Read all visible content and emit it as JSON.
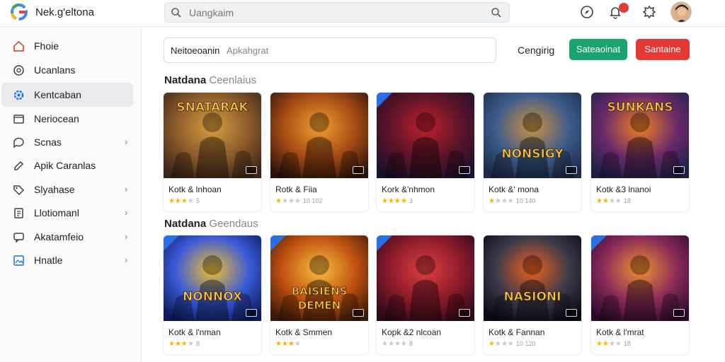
{
  "app": {
    "title": "Nek.g'eltona"
  },
  "search": {
    "placeholder": "Uangkaim"
  },
  "colors": {
    "accent_green": "#1aa36f",
    "accent_red": "#e53935",
    "ribbon_blue": "#2a6ee8",
    "star": "#f4b400"
  },
  "topbar": {
    "icons": [
      "compass-icon",
      "bell-icon",
      "settings-icon"
    ],
    "avatar": "user-avatar"
  },
  "sidebar": {
    "items": [
      {
        "label": "Fhoie",
        "icon": "home-icon",
        "chevron": false,
        "active": false
      },
      {
        "label": "Ucanlans",
        "icon": "circle-icon",
        "chevron": false,
        "active": false
      },
      {
        "label": "Kentcaban",
        "icon": "gear-icon",
        "chevron": false,
        "active": true
      },
      {
        "label": "Neriocean",
        "icon": "window-icon",
        "chevron": false,
        "active": false
      },
      {
        "label": "Scnas",
        "icon": "chat-icon",
        "chevron": true,
        "active": false
      },
      {
        "label": "Apik Caranlas",
        "icon": "pen-icon",
        "chevron": false,
        "active": false
      },
      {
        "label": "Slyahase",
        "icon": "tag-icon",
        "chevron": true,
        "active": false
      },
      {
        "label": "Llotiomanl",
        "icon": "document-icon",
        "chevron": true,
        "active": false
      },
      {
        "label": "Akatamfeio",
        "icon": "chat-bubble-icon",
        "chevron": true,
        "active": false
      },
      {
        "label": "Hnatle",
        "icon": "image-icon",
        "chevron": true,
        "active": false
      }
    ]
  },
  "toolbar": {
    "filter_label": "Neitoeoanin",
    "filter_placeholder": "Apkahgrat",
    "link_label": "Cengirig",
    "green_button": "Sateaoinat",
    "red_button": "Santaine"
  },
  "sections": [
    {
      "title_bold": "Natdana",
      "title_light": "Ceenlaius",
      "cards": [
        {
          "name": "Kotk & lnhoan",
          "stars": 3,
          "meta": "5",
          "art_text": "SNATARAK",
          "ribbon": false
        },
        {
          "name": "Rotk & Fiia",
          "stars": 1,
          "meta": "10 102",
          "art_text": "",
          "ribbon": false
        },
        {
          "name": "Kork &'nhmon",
          "stars": 4,
          "meta": "3",
          "art_text": "",
          "ribbon": true
        },
        {
          "name": "Kotk &' mona",
          "stars": 1,
          "meta": "10 140",
          "art_text": "NONSIGY",
          "ribbon": false
        },
        {
          "name": "Kotk &3 lnanoi",
          "stars": 2,
          "meta": "18",
          "art_text": "SUNKANS",
          "ribbon": false
        }
      ]
    },
    {
      "title_bold": "Natdana",
      "title_light": "Geendaus",
      "cards": [
        {
          "name": "Kotk & l'nman",
          "stars": 3,
          "meta": "8",
          "art_text": "NONNOX",
          "ribbon": true
        },
        {
          "name": "Kotk & Smmen",
          "stars": 3,
          "meta": "",
          "art_text": "BAISIENS DEMEN",
          "ribbon": true
        },
        {
          "name": "Kopk &2 nlcoan",
          "stars": 0,
          "meta": "8",
          "art_text": "",
          "ribbon": true
        },
        {
          "name": "Kotk & Fannan",
          "stars": 1,
          "meta": "10 120",
          "art_text": "NASIONI",
          "ribbon": false
        },
        {
          "name": "Kotk & l'mrat",
          "stars": 2,
          "meta": "18",
          "art_text": "",
          "ribbon": true
        }
      ]
    }
  ]
}
